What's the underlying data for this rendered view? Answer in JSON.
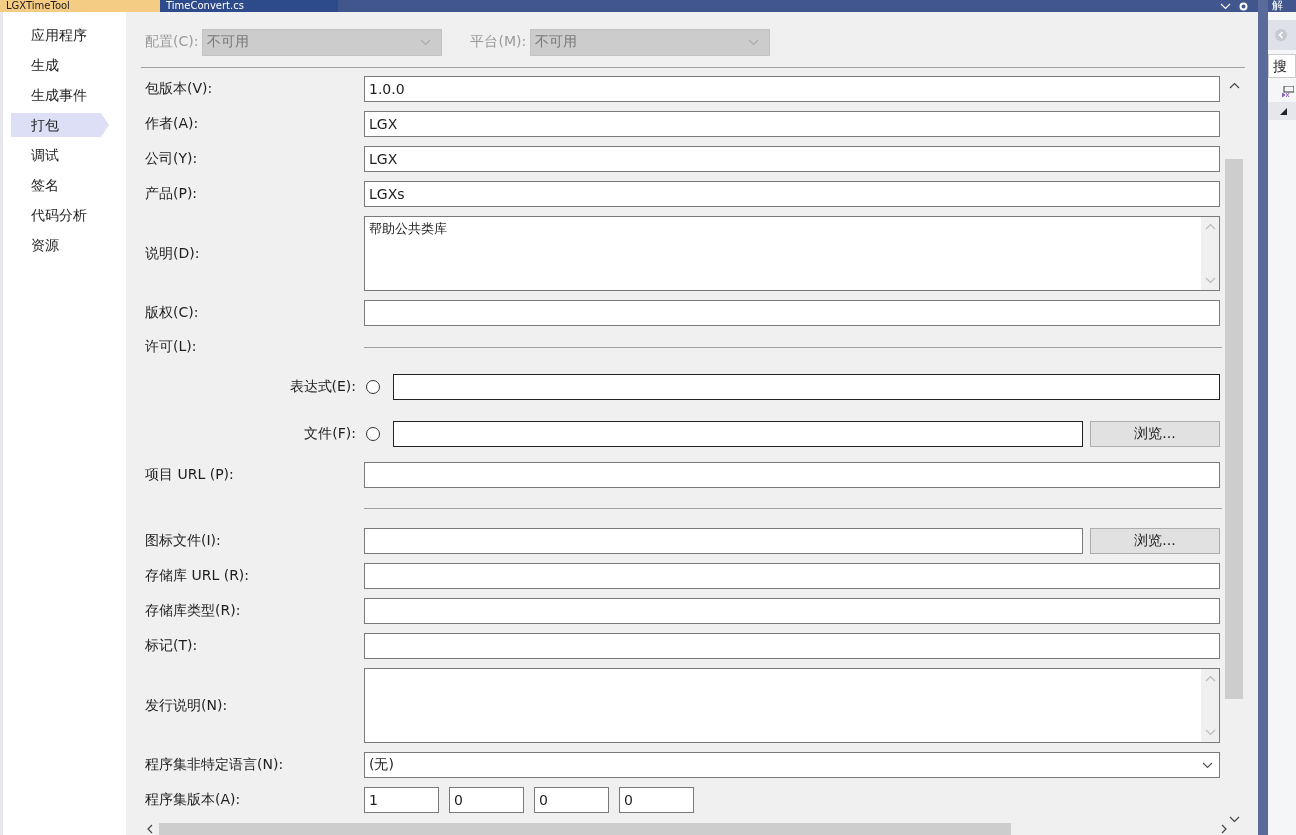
{
  "tabs": [
    {
      "label": "LGXTimeTool",
      "selected": true
    },
    {
      "label": "TimeConvert.cs",
      "selected": false
    }
  ],
  "sidebar": {
    "items": [
      {
        "label": "应用程序",
        "selected": false
      },
      {
        "label": "生成",
        "selected": false
      },
      {
        "label": "生成事件",
        "selected": false
      },
      {
        "label": "打包",
        "selected": true
      },
      {
        "label": "调试",
        "selected": false
      },
      {
        "label": "签名",
        "selected": false
      },
      {
        "label": "代码分析",
        "selected": false
      },
      {
        "label": "资源",
        "selected": false
      }
    ]
  },
  "config": [
    {
      "label": "配置(C):",
      "value": "不可用",
      "disabled": true
    },
    {
      "label": "平台(M):",
      "value": "不可用",
      "disabled": true
    }
  ],
  "fields": [
    {
      "kind": "text",
      "label": "包版本(V):",
      "value": "1.0.0"
    },
    {
      "kind": "text",
      "label": "作者(A):",
      "value": "LGX"
    },
    {
      "kind": "text",
      "label": "公司(Y):",
      "value": "LGX"
    },
    {
      "kind": "text",
      "label": "产品(P):",
      "value": "LGXs"
    },
    {
      "kind": "textarea",
      "label": "说明(D):",
      "value": "帮助公共类库"
    },
    {
      "kind": "text",
      "label": "版权(C):"
    },
    {
      "kind": "section",
      "label": "许可(L):"
    },
    {
      "kind": "radio",
      "label": "表达式(E):",
      "selected": false
    },
    {
      "kind": "radio",
      "label": "文件(F):",
      "selected": false,
      "button": "浏览..."
    },
    {
      "kind": "text",
      "label": "项目 URL (P):"
    },
    {
      "kind": "separator"
    },
    {
      "kind": "text",
      "label": "图标文件(I):",
      "button": "浏览..."
    },
    {
      "kind": "text",
      "label": "存储库 URL (R):"
    },
    {
      "kind": "text",
      "label": "存储库类型(R):"
    },
    {
      "kind": "text",
      "label": "标记(T):"
    },
    {
      "kind": "textarea",
      "label": "发行说明(N):"
    },
    {
      "kind": "dropdown",
      "label": "程序集非特定语言(N):",
      "value": "(无)"
    },
    {
      "kind": "version",
      "label": "程序集版本(A):",
      "values": [
        "1",
        "0",
        "0",
        "0"
      ]
    }
  ],
  "solution_explorer": {
    "title": "解",
    "search": "搜"
  }
}
